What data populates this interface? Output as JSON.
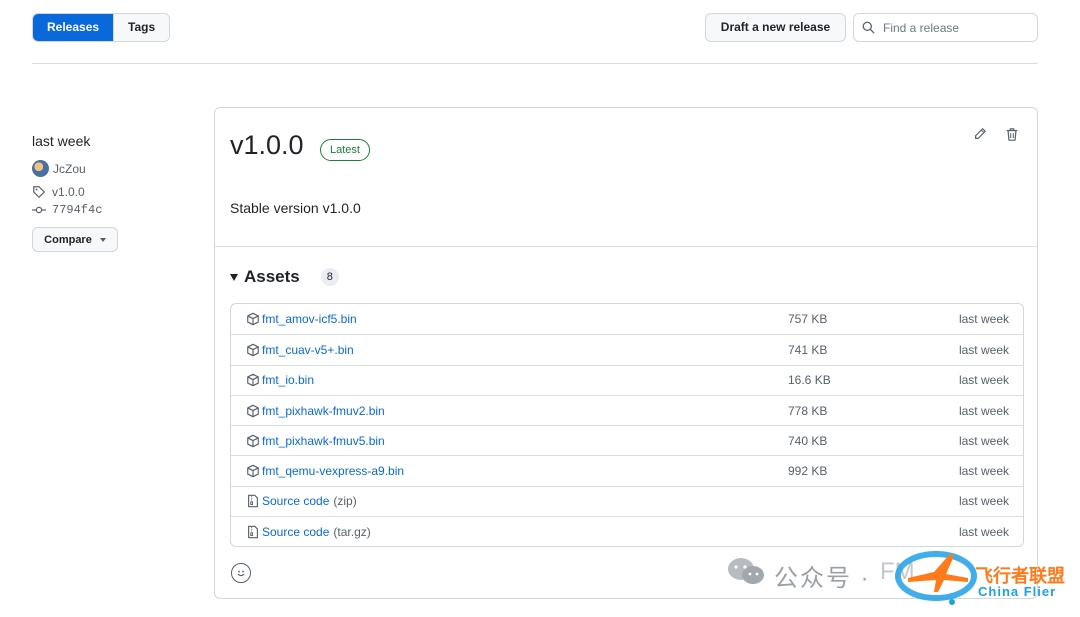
{
  "tabs": [
    {
      "label": "Releases",
      "active": true
    },
    {
      "label": "Tags",
      "active": false
    }
  ],
  "toolbar": {
    "draft_label": "Draft a new release",
    "search_placeholder": "Find a release"
  },
  "meta": {
    "date": "last week",
    "author": "JcZou",
    "tag": "v1.0.0",
    "commit": "7794f4c",
    "compare_label": "Compare"
  },
  "release": {
    "title": "v1.0.0",
    "badge": "Latest",
    "body": "Stable version v1.0.0"
  },
  "assets": {
    "title": "Assets",
    "count": "8",
    "items": [
      {
        "name": "fmt_amov-icf5.bin",
        "suffix": "",
        "size": "757 KB",
        "date": "last week",
        "icon": "package-icon"
      },
      {
        "name": "fmt_cuav-v5+.bin",
        "suffix": "",
        "size": "741 KB",
        "date": "last week",
        "icon": "package-icon"
      },
      {
        "name": "fmt_io.bin",
        "suffix": "",
        "size": "16.6 KB",
        "date": "last week",
        "icon": "package-icon"
      },
      {
        "name": "fmt_pixhawk-fmuv2.bin",
        "suffix": "",
        "size": "778 KB",
        "date": "last week",
        "icon": "package-icon"
      },
      {
        "name": "fmt_pixhawk-fmuv5.bin",
        "suffix": "",
        "size": "740 KB",
        "date": "last week",
        "icon": "package-icon"
      },
      {
        "name": "fmt_qemu-vexpress-a9.bin",
        "suffix": "",
        "size": "992 KB",
        "date": "last week",
        "icon": "package-icon"
      },
      {
        "name": "Source code",
        "suffix": "(zip)",
        "size": "",
        "date": "last week",
        "icon": "file-zip-icon"
      },
      {
        "name": "Source code",
        "suffix": "(tar.gz)",
        "size": "",
        "date": "last week",
        "icon": "file-zip-icon"
      }
    ]
  },
  "watermark": {
    "account_label": "公众号 ·",
    "brand_partial": "FM",
    "brand_cn": "飞行者联盟",
    "brand_en": "China Flier"
  },
  "colors": {
    "accent": "#0969da",
    "latest_badge": "#1a7f37",
    "watermark_orange": "#ff7a1a",
    "watermark_blue": "#1fa0e6"
  }
}
